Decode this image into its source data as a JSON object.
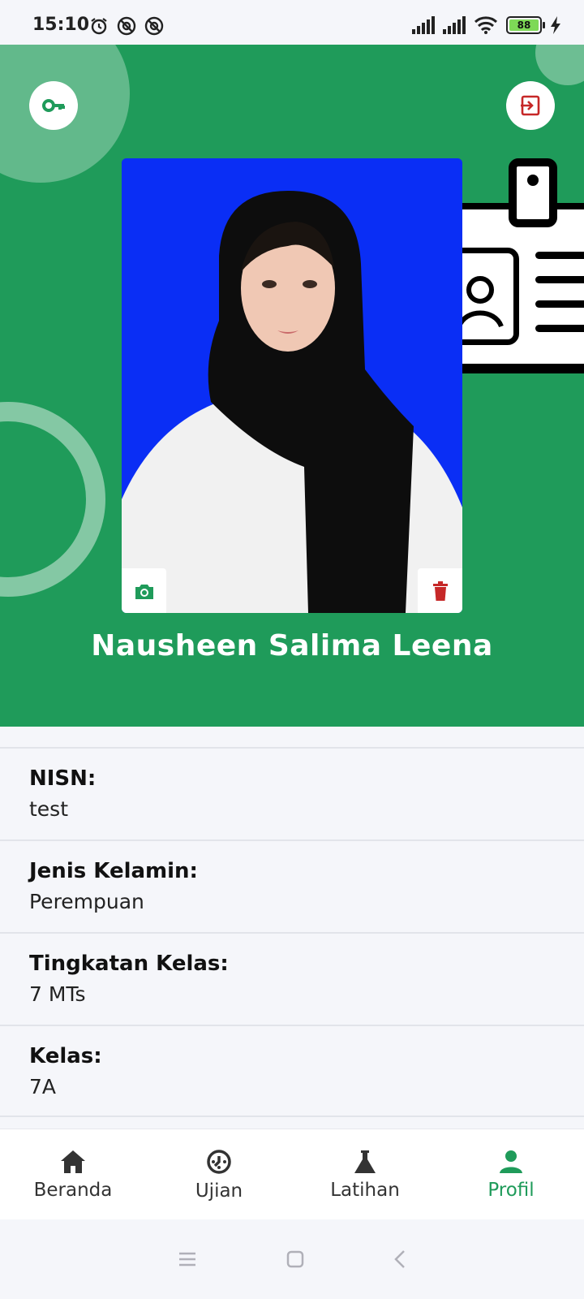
{
  "status_bar": {
    "time": "15:10",
    "battery": "88"
  },
  "profile": {
    "name": "Nausheen Salima Leena"
  },
  "info": [
    {
      "label": "NISN:",
      "value": "test"
    },
    {
      "label": "Jenis Kelamin:",
      "value": "Perempuan"
    },
    {
      "label": "Tingkatan Kelas:",
      "value": "7 MTs"
    },
    {
      "label": "Kelas:",
      "value": "7A"
    }
  ],
  "nav": [
    {
      "label": "Beranda",
      "icon": "home-icon"
    },
    {
      "label": "Ujian",
      "icon": "timer-icon"
    },
    {
      "label": "Latihan",
      "icon": "flask-icon"
    },
    {
      "label": "Profil",
      "icon": "person-icon"
    }
  ],
  "colors": {
    "primary": "#1f9b5a",
    "danger": "#c62828",
    "photo_background": "#0a2ef5"
  }
}
